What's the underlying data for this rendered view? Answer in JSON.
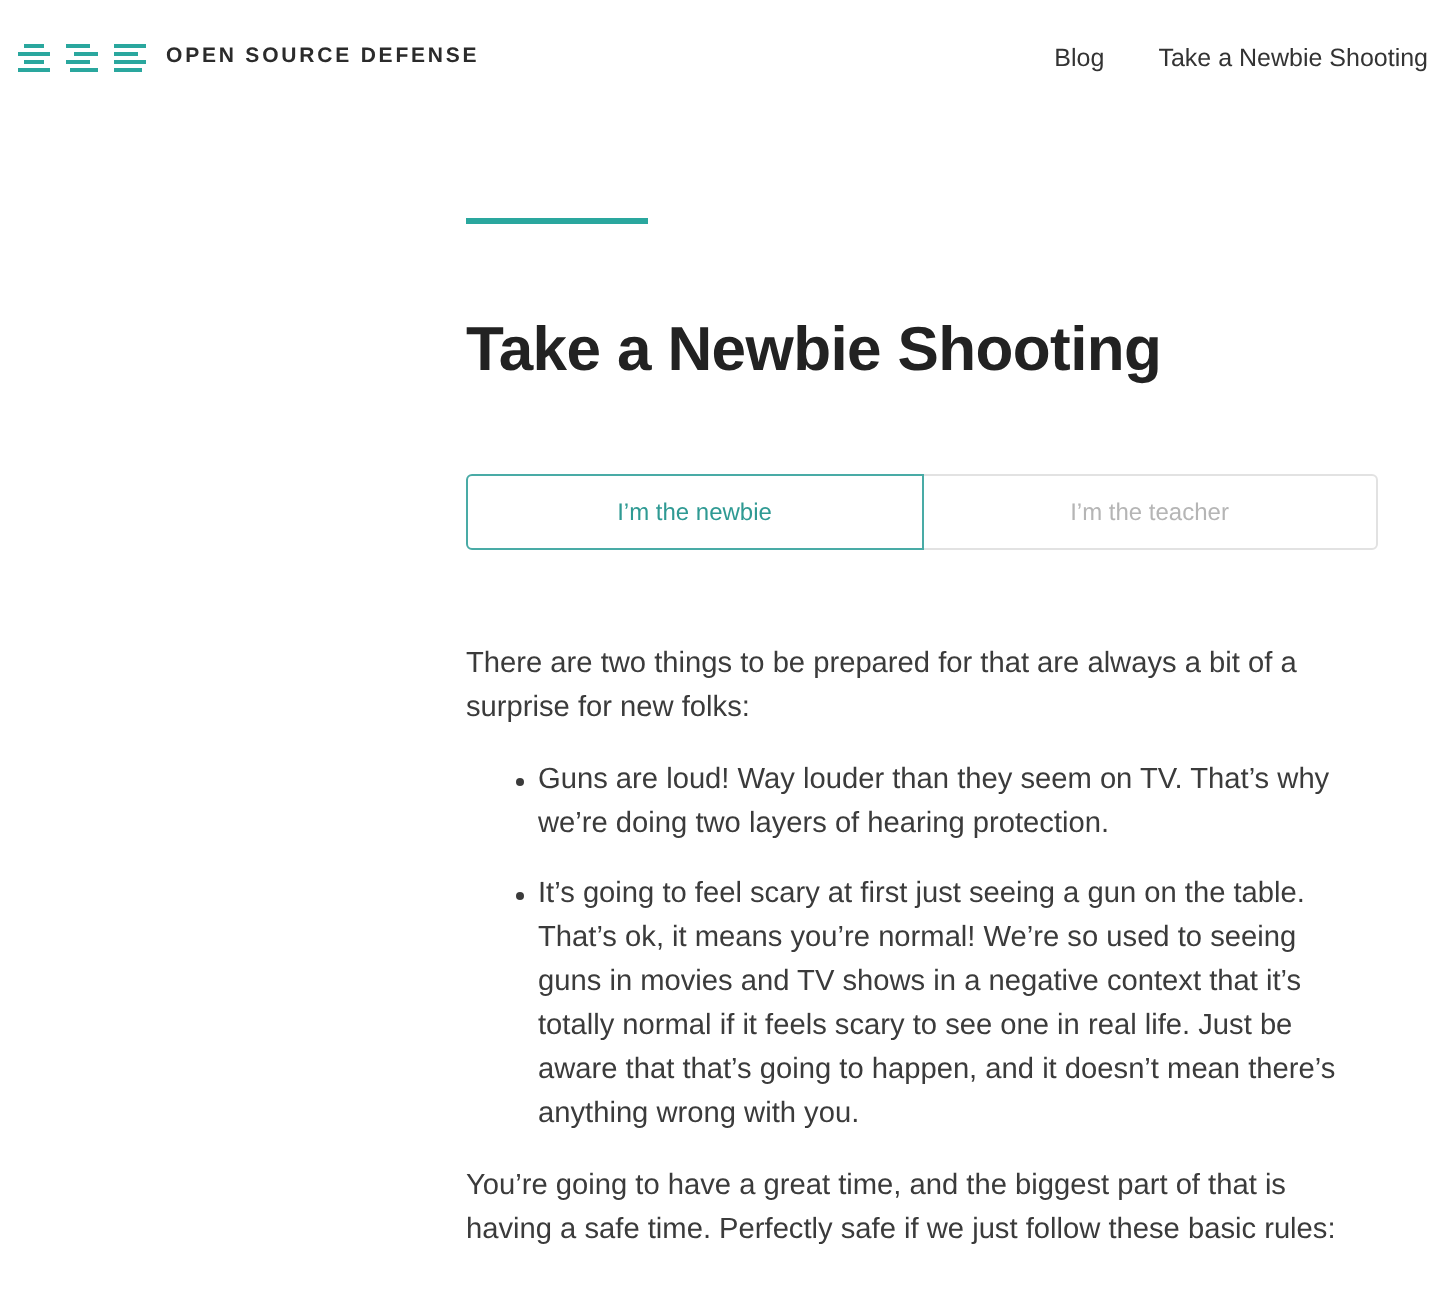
{
  "header": {
    "logo": {
      "text": "OPEN SOURCE DEFENSE"
    },
    "nav": [
      {
        "label": "Blog"
      },
      {
        "label": "Take a Newbie Shooting"
      }
    ]
  },
  "page": {
    "title": "Take a Newbie Shooting",
    "toggle": [
      {
        "label": "I’m the newbie",
        "selected": true
      },
      {
        "label": "I’m the teacher",
        "selected": false
      }
    ],
    "content": [
      {
        "kind": "paragraph",
        "text": "There are two things to be prepared for that are always a bit of a surprise for new folks:"
      },
      {
        "kind": "list",
        "items": [
          "Guns are loud! Way louder than they seem on TV. That’s why we’re doing two layers of hearing protection.",
          "It’s going to feel scary at first just seeing a gun on the table. That’s ok, it means you’re normal! We’re so used to seeing guns in movies and TV shows in a negative context that it’s totally normal if it feels scary to see one in real life. Just be aware that that’s going to happen, and it doesn’t mean there’s anything wrong with you."
        ]
      },
      {
        "kind": "paragraph",
        "text": "You’re going to have a great time, and the biggest part of that is having a safe time. Perfectly safe if we just follow these basic rules:"
      }
    ]
  }
}
